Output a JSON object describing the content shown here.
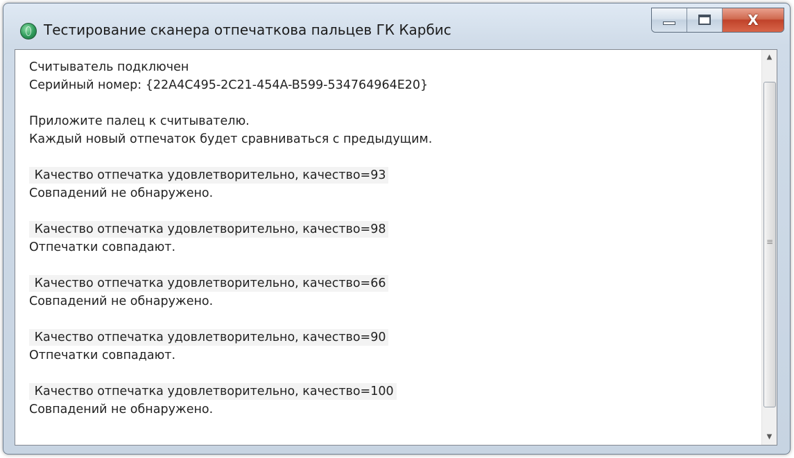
{
  "window": {
    "title": "Тестирование сканера отпечаткова пальцев ГК Карбис",
    "icon": "fingerprint-app-icon",
    "buttons": {
      "minimize": "minimize-icon",
      "maximize": "maximize-icon",
      "close_glyph": "X"
    }
  },
  "log": {
    "lines": [
      "Считыватель подключен",
      "Серийный номер: {22A4C495-2C21-454A-B599-534764964E20}",
      "",
      "Приложите палец к считывателю.",
      "Каждый новый отпечаток будет сравниваться с предыдущим.",
      "",
      " Качество отпечатка удовлетворительно, качество=93",
      "Совпадений не обнаружено.",
      "",
      " Качество отпечатка удовлетворительно, качество=98",
      "Отпечатки совпадают.",
      "",
      " Качество отпечатка удовлетворительно, качество=66",
      "Совпадений не обнаружено.",
      "",
      " Качество отпечатка удовлетворительно, качество=90",
      "Отпечатки совпадают.",
      "",
      " Качество отпечатка удовлетворительно, качество=100",
      "Совпадений не обнаружено."
    ]
  },
  "scrollbar": {
    "up_glyph": "▲",
    "down_glyph": "▼",
    "grip_glyph": "≡"
  },
  "colors": {
    "close_button": "#c0422a",
    "title_bar": "#d4dfeb"
  }
}
